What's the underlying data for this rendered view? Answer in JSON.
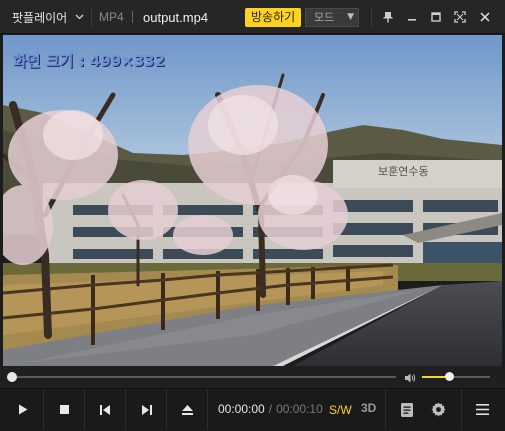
{
  "app": {
    "menu_label": "팟플레이어",
    "format": "MP4",
    "filename": "output.mp4"
  },
  "titlebar": {
    "broadcast_label": "방송하기",
    "mode_label": "모드"
  },
  "video": {
    "osd_text": "화면 크기 : 499×332",
    "sign_text": "보훈연수동"
  },
  "playback": {
    "current_time": "00:00:00",
    "separator": "/",
    "total_time": "00:00:10",
    "position": 0.0,
    "volume": 0.4
  },
  "controls": {
    "sw_label": "S/W",
    "three_d_label": "3D"
  },
  "icons": [
    "chevron-down-icon",
    "pin-icon",
    "minimize-icon",
    "maximize-icon",
    "fullscreen-icon",
    "close-icon",
    "volume-icon",
    "play-icon",
    "stop-icon",
    "previous-icon",
    "next-icon",
    "eject-icon",
    "playlist-icon",
    "settings-icon",
    "menu-icon"
  ],
  "colors": {
    "accent": "#ffd21f",
    "background": "#1c1c1c",
    "osd": "#6f8fd9"
  }
}
